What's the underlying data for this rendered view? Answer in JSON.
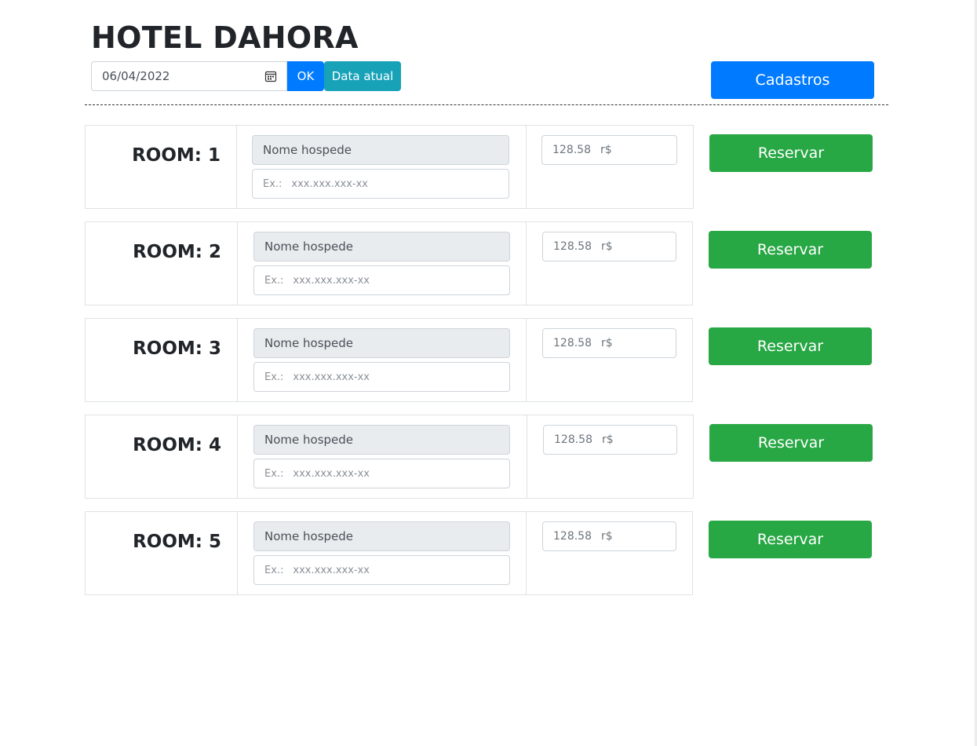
{
  "header": {
    "title": "HOTEL DAHORA",
    "date_value": "06/04/2022",
    "ok_label": "OK",
    "today_label": "Data atual",
    "cadastros_label": "Cadastros"
  },
  "rooms": [
    {
      "label": "ROOM: 1",
      "name_placeholder": "Nome hospede",
      "cpf_prefix": "Ex.:",
      "cpf_placeholder": "xxx.xxx.xxx-xx",
      "price": "128.58",
      "currency": "r$",
      "reserve_label": "Reservar"
    },
    {
      "label": "ROOM: 2",
      "name_placeholder": "Nome hospede",
      "cpf_prefix": "Ex.:",
      "cpf_placeholder": "xxx.xxx.xxx-xx",
      "price": "128.58",
      "currency": "r$",
      "reserve_label": "Reservar"
    },
    {
      "label": "ROOM: 3",
      "name_placeholder": "Nome hospede",
      "cpf_prefix": "Ex.:",
      "cpf_placeholder": "xxx.xxx.xxx-xx",
      "price": "128.58",
      "currency": "r$",
      "reserve_label": "Reservar"
    },
    {
      "label": "ROOM: 4",
      "name_placeholder": "Nome hospede",
      "cpf_prefix": "Ex.:",
      "cpf_placeholder": "xxx.xxx.xxx-xx",
      "price": "128.58",
      "currency": "r$",
      "reserve_label": "Reservar"
    },
    {
      "label": "ROOM: 5",
      "name_placeholder": "Nome hospede",
      "cpf_prefix": "Ex.:",
      "cpf_placeholder": "xxx.xxx.xxx-xx",
      "price": "128.58",
      "currency": "r$",
      "reserve_label": "Reservar"
    }
  ],
  "icons": {
    "date_picker": "calendar-icon"
  },
  "colors": {
    "primary": "#007bff",
    "info": "#17a2b8",
    "success": "#28a745",
    "readonly_bg": "#e9ecef"
  }
}
